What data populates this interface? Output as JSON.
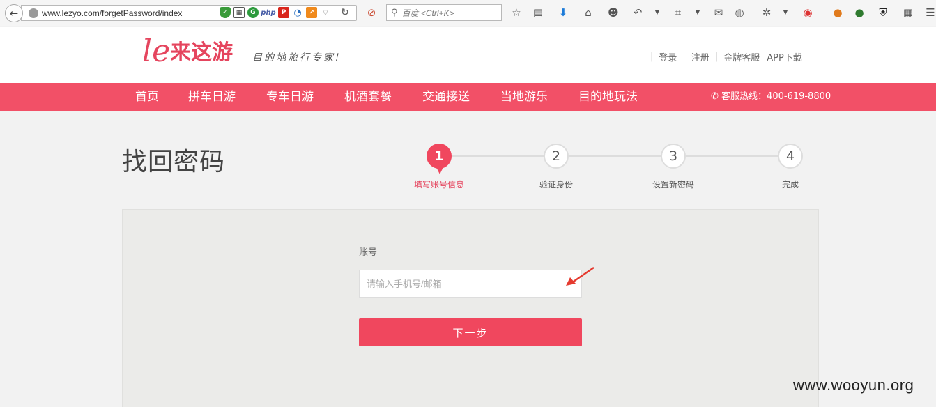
{
  "browser": {
    "url": "www.lezyo.com/forgetPassword/index",
    "search_placeholder": "百度 <Ctrl+K>",
    "addons": [
      "shield-icon",
      "qr-icon",
      "g-icon",
      "php-icon",
      "p-icon",
      "wifi-icon",
      "chart-icon"
    ]
  },
  "header": {
    "logo_mark": "le",
    "logo_text": "来这游",
    "slogan": "目的地旅行专家!",
    "links": [
      "登录",
      "注册",
      "金牌客服",
      "APP下载"
    ]
  },
  "nav": {
    "items": [
      "首页",
      "拼车日游",
      "专车日游",
      "机酒套餐",
      "交通接送",
      "当地游乐",
      "目的地玩法"
    ],
    "hotline": "客服热线：400-619-8800"
  },
  "page": {
    "title": "找回密码",
    "steps": [
      {
        "number": "1",
        "label": "填写账号信息",
        "active": true
      },
      {
        "number": "2",
        "label": "验证身份",
        "active": false
      },
      {
        "number": "3",
        "label": "设置新密码",
        "active": false
      },
      {
        "number": "4",
        "label": "完成",
        "active": false
      }
    ]
  },
  "form": {
    "account_label": "账号",
    "account_placeholder": "请输入手机号/邮箱",
    "account_value": "",
    "next_button": "下一步"
  },
  "watermark": "www.wooyun.org",
  "colors": {
    "accent": "#f25067",
    "brand": "#e5455e"
  }
}
